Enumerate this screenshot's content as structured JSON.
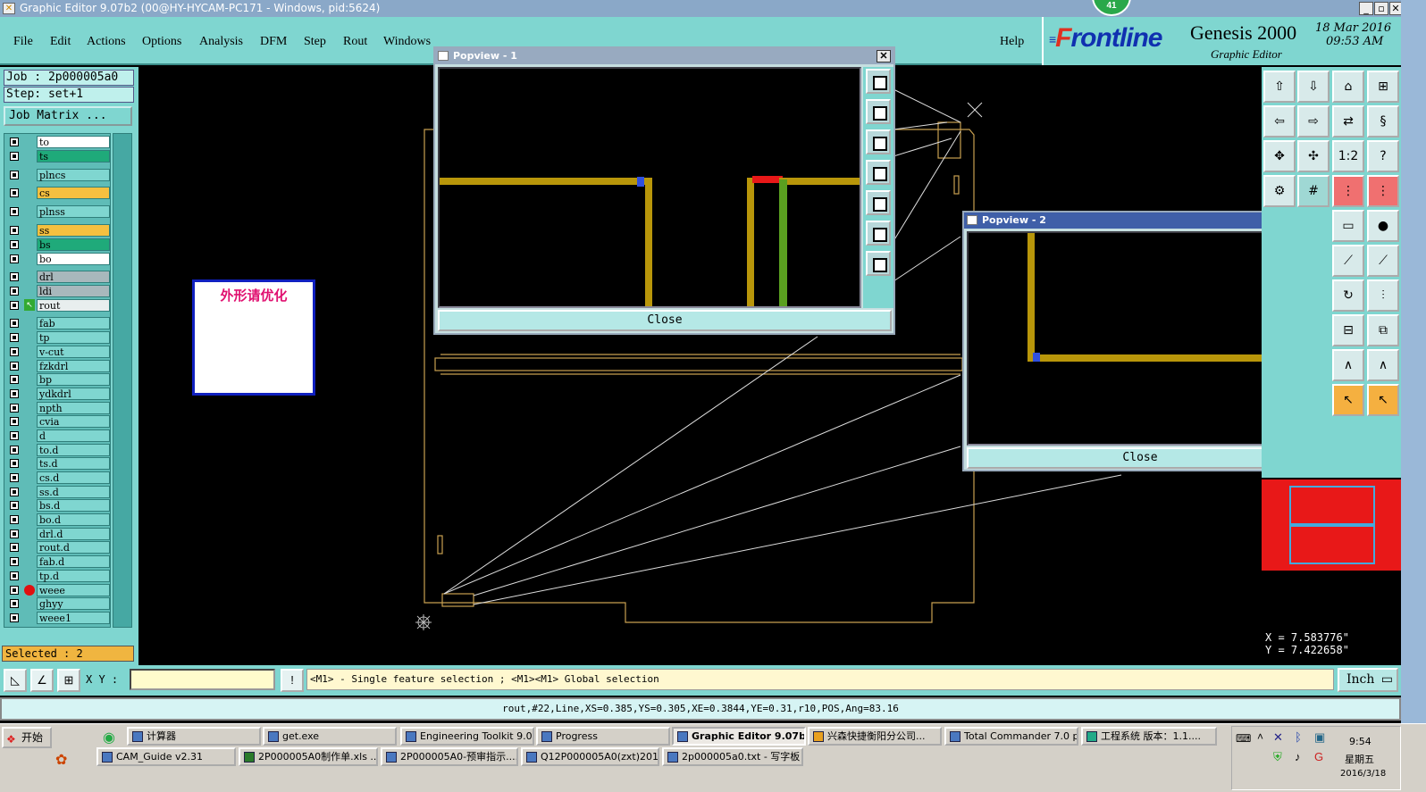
{
  "window": {
    "title": "Graphic Editor 9.07b2 (00@HY-HYCAM-PC171 - Windows, pid:5624)",
    "badge": "41"
  },
  "menu": [
    "File",
    "Edit",
    "Actions",
    "Options",
    "Analysis",
    "DFM",
    "Step",
    "Rout",
    "Windows"
  ],
  "help": "Help",
  "brand": {
    "logo_f": "F",
    "logo_rest": "rontline",
    "product": "Genesis 2000",
    "subtitle": "Graphic Editor",
    "date": "18 Mar 2016",
    "time": "09:53 AM"
  },
  "job": {
    "job_label": "Job : 2p000005a0",
    "step_label": "Step: set+1",
    "matrix_button": "Job Matrix ..."
  },
  "layers": [
    {
      "name": "to",
      "color": "#ffffff"
    },
    {
      "name": "ts",
      "color": "#1faa7a"
    },
    {
      "name": "plncs",
      "color": "#7fd6d0"
    },
    {
      "name": "cs",
      "color": "#f5c040"
    },
    {
      "name": "plnss",
      "color": "#7fd6d0"
    },
    {
      "name": "ss",
      "color": "#f5c040"
    },
    {
      "name": "bs",
      "color": "#1faa7a"
    },
    {
      "name": "bo",
      "color": "#ffffff"
    },
    {
      "name": "drl",
      "color": "#a8b8bc"
    },
    {
      "name": "ldi",
      "color": "#a8b8bc"
    },
    {
      "name": "rout",
      "color": "#e8eeee"
    },
    {
      "name": "fab",
      "color": "#7fd6d0"
    },
    {
      "name": "tp",
      "color": "#7fd6d0"
    },
    {
      "name": "v-cut",
      "color": "#7fd6d0"
    },
    {
      "name": "fzkdrl",
      "color": "#7fd6d0"
    },
    {
      "name": "bp",
      "color": "#7fd6d0"
    },
    {
      "name": "ydkdrl",
      "color": "#7fd6d0"
    },
    {
      "name": "npth",
      "color": "#7fd6d0"
    },
    {
      "name": "cvia",
      "color": "#7fd6d0"
    },
    {
      "name": "d",
      "color": "#7fd6d0"
    },
    {
      "name": "to.d",
      "color": "#7fd6d0"
    },
    {
      "name": "ts.d",
      "color": "#7fd6d0"
    },
    {
      "name": "cs.d",
      "color": "#7fd6d0"
    },
    {
      "name": "ss.d",
      "color": "#7fd6d0"
    },
    {
      "name": "bs.d",
      "color": "#7fd6d0"
    },
    {
      "name": "bo.d",
      "color": "#7fd6d0"
    },
    {
      "name": "drl.d",
      "color": "#7fd6d0"
    },
    {
      "name": "rout.d",
      "color": "#7fd6d0"
    },
    {
      "name": "fab.d",
      "color": "#7fd6d0"
    },
    {
      "name": "tp.d",
      "color": "#7fd6d0"
    },
    {
      "name": "weee",
      "color": "#7fd6d0"
    },
    {
      "name": "ghyy",
      "color": "#7fd6d0"
    },
    {
      "name": "weee1",
      "color": "#7fd6d0"
    }
  ],
  "selected_label": "Selected : 2",
  "note_text": "外形请优化",
  "popview1": {
    "title": "Popview - 1",
    "close_label": "Close"
  },
  "popview2": {
    "title": "Popview - 2",
    "close_label": "Close"
  },
  "tool_icons": [
    "1:2",
    "?"
  ],
  "coords": {
    "x": "X = 7.583776\"",
    "y": "Y = 7.422658\""
  },
  "xy_label": "X Y :",
  "xy_value": "",
  "message": "<M1> - Single feature selection ; <M1><M1> Global selection",
  "unit_button": "Inch",
  "status_line": "rout,#22,Line,XS=0.385,YS=0.305,XE=0.3844,YE=0.31,r10,POS,Ang=83.16",
  "taskbar": {
    "start": "开始",
    "row1": [
      "计算器",
      "get.exe",
      "Engineering Toolkit 9.0...",
      "Progress",
      "Graphic Editor 9.07b...",
      "兴森快捷衡阳分公司...",
      "Total Commander 7.0 p...",
      "工程系统  版本：1.1...."
    ],
    "row2": [
      "CAM_Guide v2.31",
      "2P000005A0制作单.xls ...",
      "2P000005A0-预审指示....",
      "Q12P000005A0(zxt)201...",
      "2p000005a0.txt - 写字板"
    ],
    "clock": "9:54",
    "weekday": "星期五",
    "date": "2016/3/18"
  },
  "colors": {
    "board": "#c8a050",
    "trace": "#b8960a",
    "accent": "#7fd6d0"
  }
}
